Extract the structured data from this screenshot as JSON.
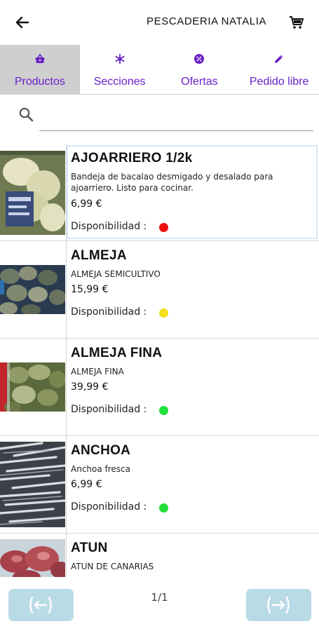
{
  "header": {
    "title": "PESCADERIA NATALIA",
    "back_icon": "arrow-left-icon",
    "cart_icon": "cart-icon"
  },
  "tabs": [
    {
      "label": "Productos",
      "icon": "basket-icon",
      "active": true
    },
    {
      "label": "Secciones",
      "icon": "snowflake-icon",
      "active": false
    },
    {
      "label": "Ofertas",
      "icon": "percent-icon",
      "active": false
    },
    {
      "label": "Pedido libre",
      "icon": "pencil-icon",
      "active": false
    }
  ],
  "search": {
    "value": "",
    "placeholder": "",
    "icon": "search-icon"
  },
  "products": [
    {
      "name": "AJOARRIERO 1/2k",
      "description": "Bandeja de bacalao desmigado y desalado para ajoarriero. Listo para cocinar.",
      "price": "6,99 €",
      "availability_label": "Disponibilidad :",
      "availability_color": "#ee1111"
    },
    {
      "name": "ALMEJA",
      "description": "ALMEJA SEMICULTIVO",
      "price": "15,99 €",
      "availability_label": "Disponibilidad :",
      "availability_color": "#f2e01a"
    },
    {
      "name": "ALMEJA FINA",
      "description": "ALMEJA FINA",
      "price": "39,99 €",
      "availability_label": "Disponibilidad :",
      "availability_color": "#22e03a"
    },
    {
      "name": "ANCHOA",
      "description": "Anchoa fresca",
      "price": "6,99 €",
      "availability_label": "Disponibilidad :",
      "availability_color": "#22e03a"
    },
    {
      "name": "ATUN",
      "description": "ATUN DE CANARIAS",
      "price": "",
      "availability_label": "",
      "availability_color": ""
    }
  ],
  "pagination": {
    "page_text": "1/1",
    "prev_icon": "arrow-left-bracket-icon",
    "next_icon": "arrow-right-bracket-icon"
  },
  "colors": {
    "accent": "#6a1fc9",
    "tab_active_bg": "#cfcfcf",
    "nav_button_bg": "#b9dbe6",
    "selected_border": "#d7e8f6"
  }
}
